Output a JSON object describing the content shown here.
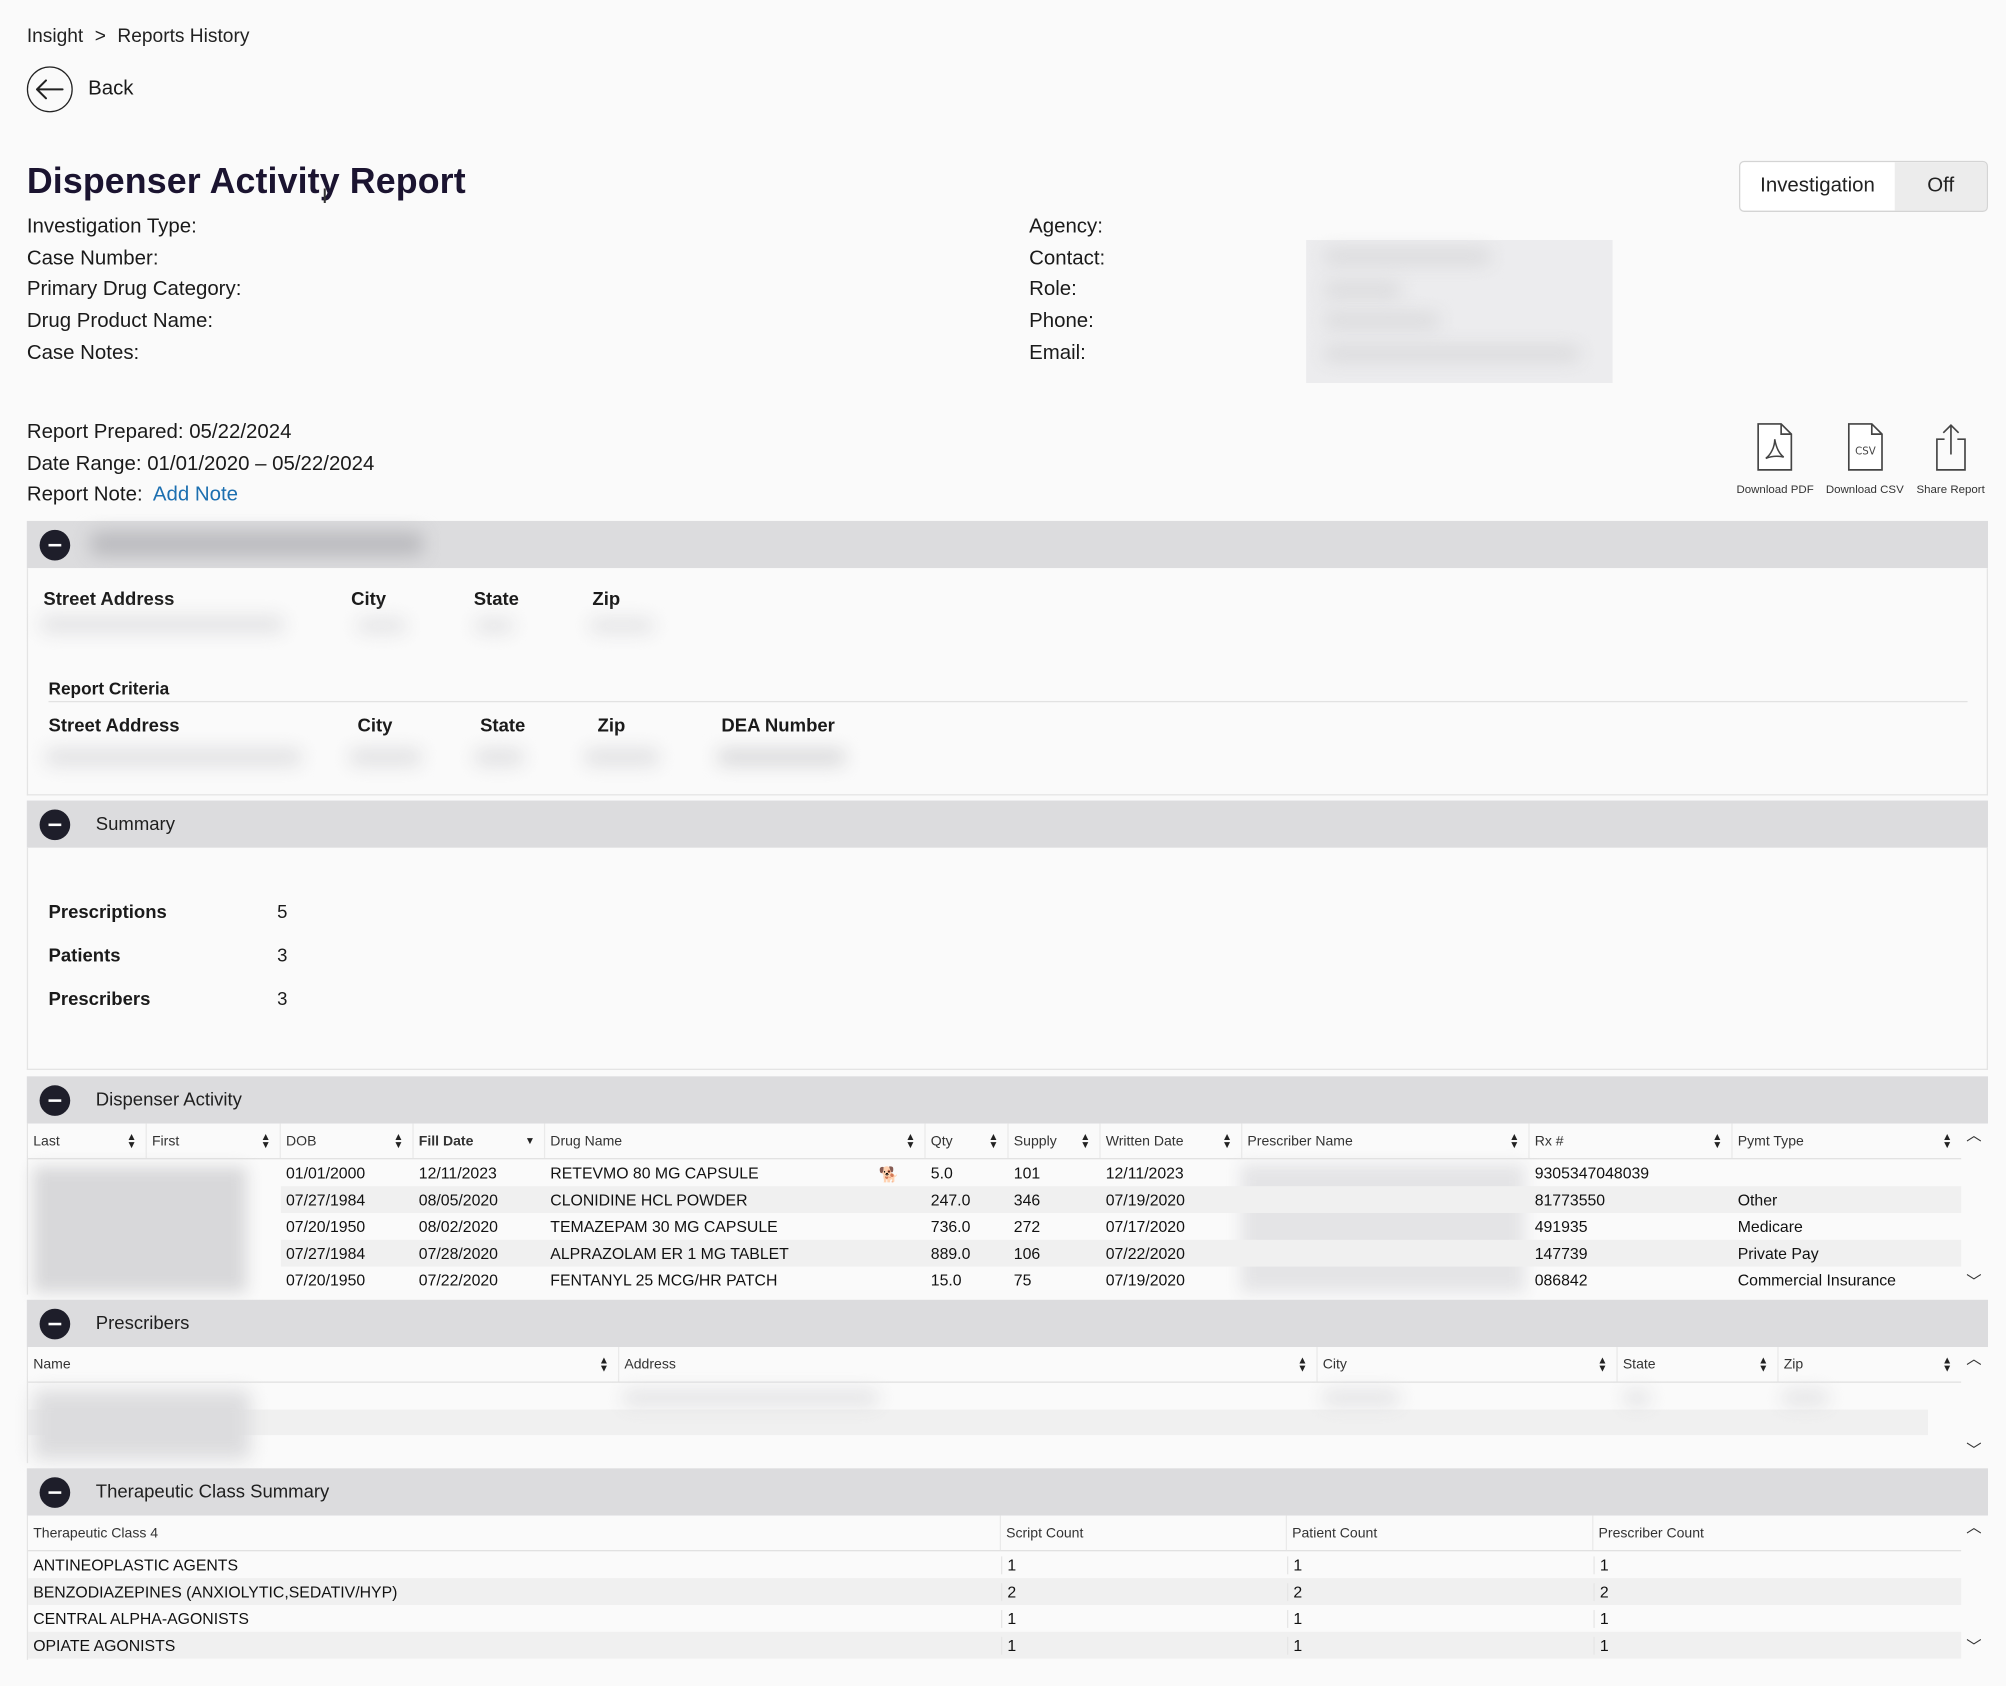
{
  "breadcrumb": {
    "root": "Insight",
    "separator": ">",
    "current": "Reports History"
  },
  "back": {
    "label": "Back"
  },
  "page": {
    "title": "Dispenser Activity Report"
  },
  "toggle": {
    "label": "Investigation",
    "value": "Off"
  },
  "case_info": {
    "labels": [
      "Investigation Type:",
      "Case Number:",
      "Primary Drug Category:",
      "Drug Product Name:",
      "Case Notes:"
    ]
  },
  "agency_info": {
    "labels": [
      "Agency:",
      "Contact:",
      "Role:",
      "Phone:",
      "Email:"
    ]
  },
  "report_meta": {
    "prepared": "Report Prepared: 05/22/2024",
    "date_range": "Date Range: 01/01/2020 – 05/22/2024",
    "note_label": "Report Note:",
    "add_note": "Add Note"
  },
  "actions": {
    "pdf": "Download PDF",
    "csv": "Download CSV",
    "csv_badge": "CSV",
    "share": "Share Report"
  },
  "dispenser_panel": {
    "headers": [
      "Street Address",
      "City",
      "State",
      "Zip"
    ],
    "criteria_title": "Report Criteria",
    "criteria_headers": [
      "Street Address",
      "City",
      "State",
      "Zip",
      "DEA Number"
    ]
  },
  "summary": {
    "title": "Summary",
    "items": [
      {
        "label": "Prescriptions",
        "value": "5"
      },
      {
        "label": "Patients",
        "value": "3"
      },
      {
        "label": "Prescribers",
        "value": "3"
      }
    ]
  },
  "dispenser_activity": {
    "title": "Dispenser Activity",
    "columns": [
      "Last",
      "First",
      "DOB",
      "Fill Date",
      "Drug Name",
      "Qty",
      "Supply",
      "Written Date",
      "Prescriber Name",
      "Rx #",
      "Pymt Type"
    ],
    "rows": [
      {
        "dob": "01/01/2000",
        "fill": "12/11/2023",
        "drug": "RETEVMO 80 MG CAPSULE",
        "qty": "5.0",
        "supply": "101",
        "written": "12/11/2023",
        "rx": "9305347048039",
        "pymt": ""
      },
      {
        "dob": "07/27/1984",
        "fill": "08/05/2020",
        "drug": "CLONIDINE HCL POWDER",
        "qty": "247.0",
        "supply": "346",
        "written": "07/19/2020",
        "rx": "81773550",
        "pymt": "Other"
      },
      {
        "dob": "07/20/1950",
        "fill": "08/02/2020",
        "drug": "TEMAZEPAM 30 MG CAPSULE",
        "qty": "736.0",
        "supply": "272",
        "written": "07/17/2020",
        "rx": "491935",
        "pymt": "Medicare"
      },
      {
        "dob": "07/27/1984",
        "fill": "07/28/2020",
        "drug": "ALPRAZOLAM ER 1 MG TABLET",
        "qty": "889.0",
        "supply": "106",
        "written": "07/22/2020",
        "rx": "147739",
        "pymt": "Private Pay"
      },
      {
        "dob": "07/20/1950",
        "fill": "07/22/2020",
        "drug": "FENTANYL 25 MCG/HR PATCH",
        "qty": "15.0",
        "supply": "75",
        "written": "07/19/2020",
        "rx": "086842",
        "pymt": "Commercial Insurance"
      }
    ]
  },
  "prescribers": {
    "title": "Prescribers",
    "columns": [
      "Name",
      "Address",
      "City",
      "State",
      "Zip"
    ]
  },
  "therapeutic": {
    "title": "Therapeutic Class Summary",
    "columns": [
      "Therapeutic Class 4",
      "Script Count",
      "Patient Count",
      "Prescriber Count"
    ],
    "rows": [
      {
        "cls": "ANTINEOPLASTIC AGENTS",
        "script": "1",
        "patient": "1",
        "prescriber": "1"
      },
      {
        "cls": "BENZODIAZEPINES (ANXIOLYTIC,SEDATIV/HYP)",
        "script": "2",
        "patient": "2",
        "prescriber": "2"
      },
      {
        "cls": "CENTRAL ALPHA-AGONISTS",
        "script": "1",
        "patient": "1",
        "prescriber": "1"
      },
      {
        "cls": "OPIATE AGONISTS",
        "script": "1",
        "patient": "1",
        "prescriber": "1"
      }
    ]
  },
  "icons": {
    "back": "arrow-left-icon",
    "collapse": "minus-circle-icon",
    "sort": "sort-arrows-icon",
    "pdf": "pdf-file-icon",
    "csv": "csv-file-icon",
    "share": "share-icon",
    "cursor": "text-cursor-icon",
    "animal": "animal-icon"
  },
  "colors": {
    "link": "#1c6fb0",
    "section_bar": "#dcdcde",
    "title": "#1b1430"
  }
}
